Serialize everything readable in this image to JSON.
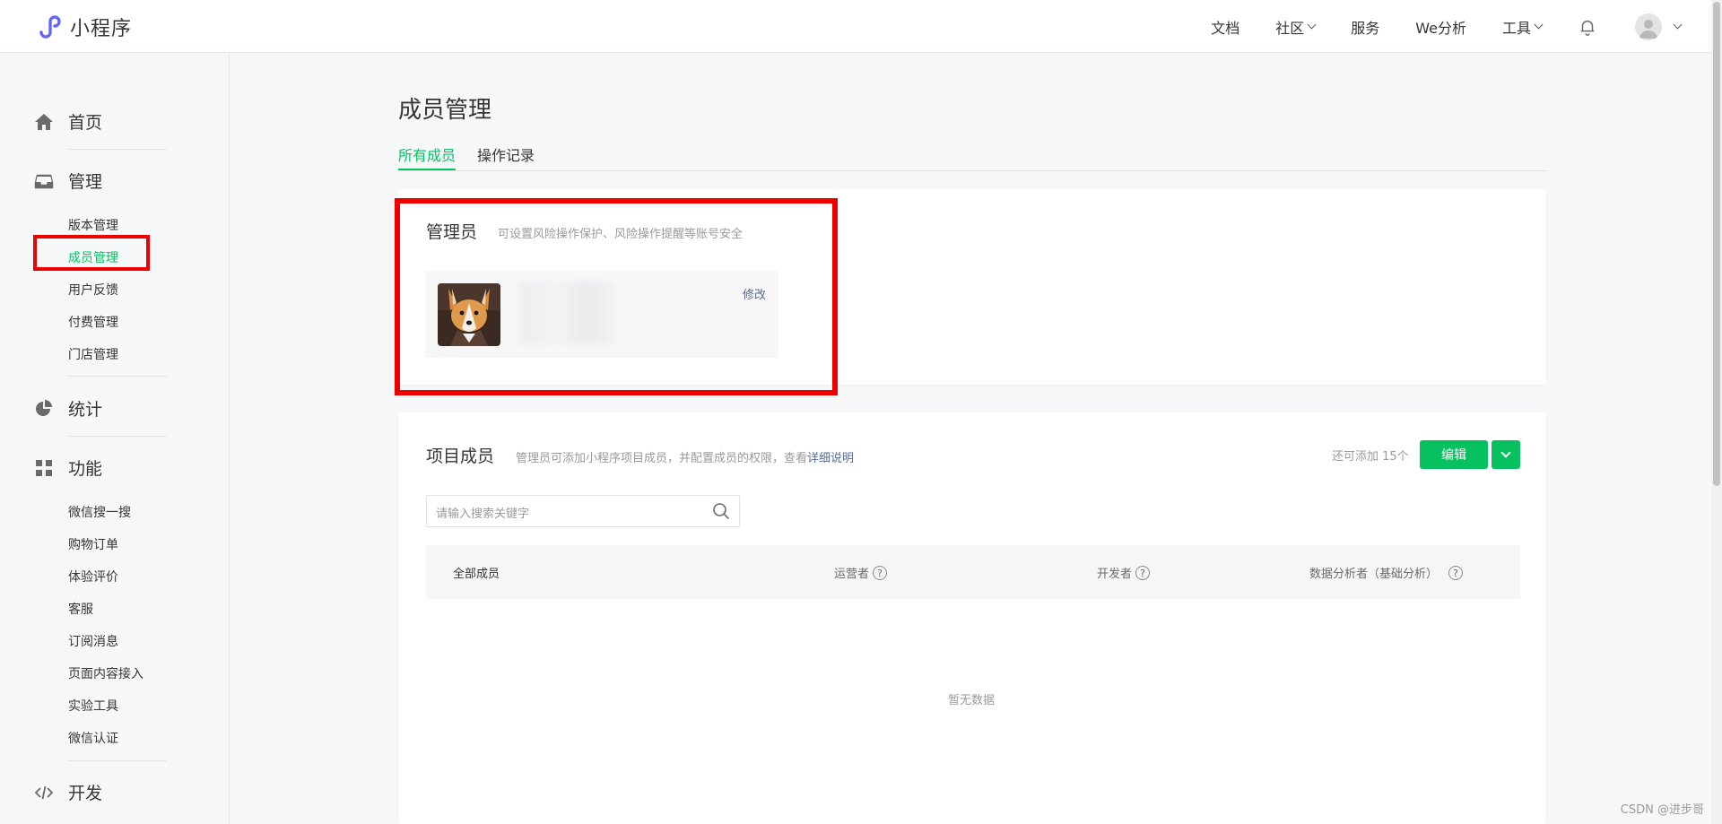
{
  "app": {
    "title": "小程序"
  },
  "topnav": {
    "items": [
      "文档",
      "社区",
      "服务",
      "We分析",
      "工具"
    ]
  },
  "sidebar": {
    "sections": {
      "home": "首页",
      "manage": "管理",
      "stats": "统计",
      "features": "功能",
      "dev": "开发"
    },
    "manage_items": [
      "版本管理",
      "成员管理",
      "用户反馈",
      "付费管理",
      "门店管理"
    ],
    "feature_items": [
      "微信搜一搜",
      "购物订单",
      "体验评价",
      "客服",
      "订阅消息",
      "页面内容接入",
      "实验工具",
      "微信认证"
    ]
  },
  "main": {
    "title": "成员管理",
    "tabs": [
      "所有成员",
      "操作记录"
    ],
    "admin": {
      "title": "管理员",
      "desc": "可设置风险操作保护、风险操作提醒等账号安全",
      "edit": "修改"
    },
    "project": {
      "title": "项目成员",
      "desc": "管理员可添加小程序项目成员，并配置成员的权限，查看",
      "desc_link": "详细说明",
      "remaining": "还可添加 15个",
      "edit_button": "编辑",
      "search_placeholder": "请输入搜索关键字",
      "columns": [
        "全部成员",
        "运营者",
        "开发者",
        "数据分析者（基础分析）"
      ],
      "empty": "暂无数据"
    }
  },
  "watermark": "CSDN @进步哥",
  "colors": {
    "accent": "#07c160",
    "highlight": "#ee0000",
    "link": "#576b95"
  }
}
